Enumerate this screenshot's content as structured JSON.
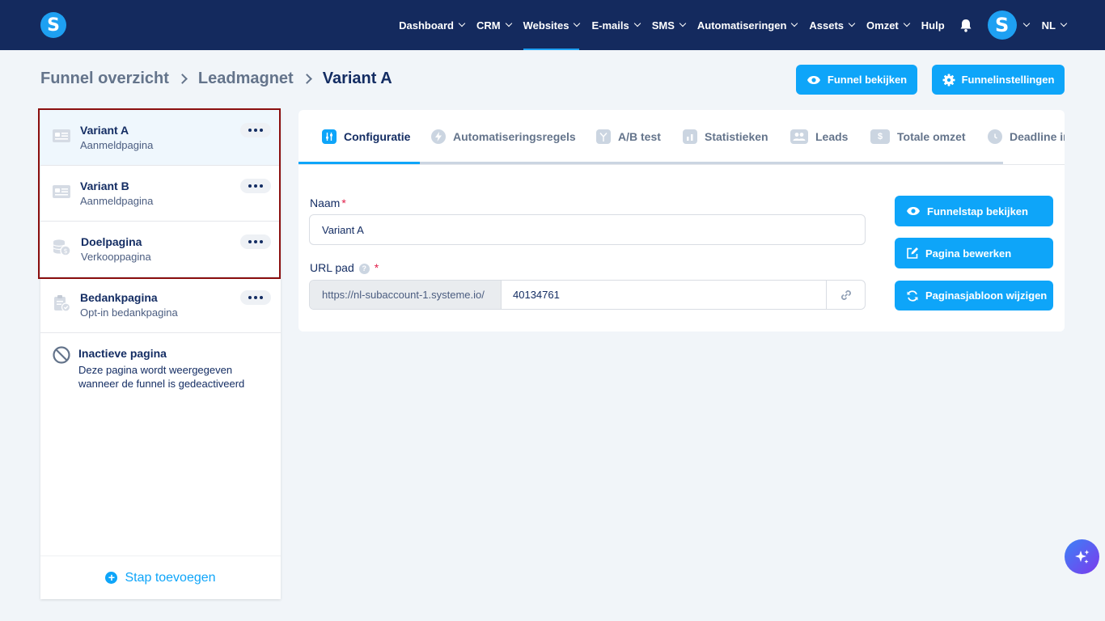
{
  "nav": {
    "items": [
      {
        "label": "Dashboard",
        "has_menu": true
      },
      {
        "label": "CRM",
        "has_menu": true
      },
      {
        "label": "Websites",
        "has_menu": true,
        "active": true
      },
      {
        "label": "E-mails",
        "has_menu": true
      },
      {
        "label": "SMS",
        "has_menu": true
      },
      {
        "label": "Automatiseringen",
        "has_menu": true
      },
      {
        "label": "Assets",
        "has_menu": true
      },
      {
        "label": "Omzet",
        "has_menu": true
      },
      {
        "label": "Hulp",
        "has_menu": false
      }
    ],
    "logo_letter": "S",
    "avatar_letter": "S",
    "language": "NL"
  },
  "breadcrumb": {
    "items": [
      "Funnel overzicht",
      "Leadmagnet",
      "Variant A"
    ]
  },
  "header_buttons": {
    "view_funnel": "Funnel bekijken",
    "funnel_settings": "Funnelinstellingen"
  },
  "steps": {
    "items": [
      {
        "title": "Variant A",
        "subtitle": "Aanmeldpagina",
        "icon": "page-form-icon",
        "selected": true
      },
      {
        "title": "Variant B",
        "subtitle": "Aanmeldpagina",
        "icon": "page-form-icon",
        "selected": false
      },
      {
        "title": "Doelpagina",
        "subtitle": "Verkooppagina",
        "icon": "coins-icon",
        "selected": false
      },
      {
        "title": "Bedankpagina",
        "subtitle": "Opt-in bedankpagina",
        "icon": "clipboard-check-icon",
        "selected": false
      }
    ],
    "inactive": {
      "title": "Inactieve pagina",
      "description": "Deze pagina wordt weergegeven wanneer de funnel is gedeactiveerd"
    },
    "add_label": "Stap toevoegen"
  },
  "tabs": {
    "items": [
      {
        "label": "Configuratie",
        "icon": "sliders-icon",
        "active": true
      },
      {
        "label": "Automatiseringsregels",
        "icon": "bolt-icon"
      },
      {
        "label": "A/B test",
        "icon": "split-icon"
      },
      {
        "label": "Statistieken",
        "icon": "bar-chart-icon"
      },
      {
        "label": "Leads",
        "icon": "users-icon"
      },
      {
        "label": "Totale omzet",
        "icon": "dollar-icon"
      },
      {
        "label": "Deadline ir",
        "icon": "clock-icon"
      }
    ]
  },
  "form": {
    "name_label": "Naam",
    "name_value": "Variant A",
    "required_mark": "*",
    "url_label": "URL pad",
    "url_help": "?",
    "url_prefix": "https://nl-subaccount-1.systeme.io/",
    "url_path": "40134761"
  },
  "actions": {
    "view_step": "Funnelstap bekijken",
    "edit_page": "Pagina bewerken",
    "change_template": "Paginasjabloon wijzigen"
  },
  "colors": {
    "nav_bg": "#142a5e",
    "accent": "#0ea5f9",
    "highlight_border": "#8b0f0f",
    "required": "#e11d48"
  }
}
